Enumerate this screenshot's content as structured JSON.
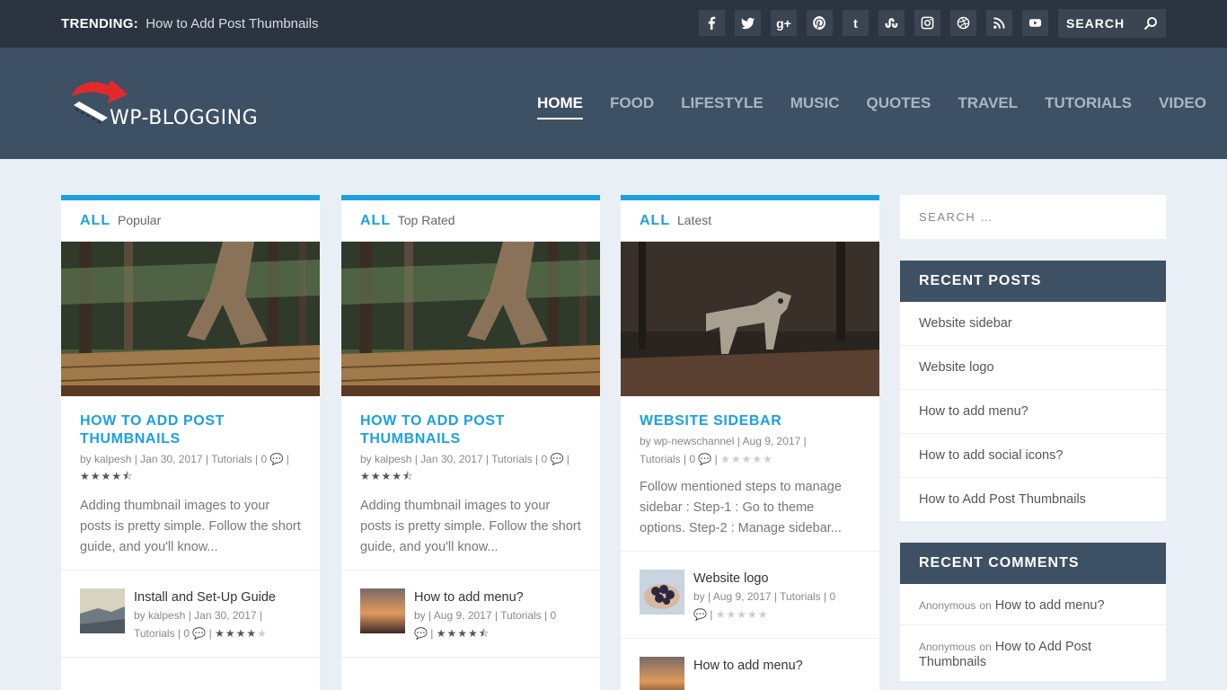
{
  "topbar": {
    "trending_label": "TRENDING:",
    "trending_text": "How to Add Post Thumbnails",
    "social_icons": [
      "facebook-icon",
      "twitter-icon",
      "google-plus-icon",
      "pinterest-icon",
      "tumblr-icon",
      "stumbleupon-icon",
      "instagram-icon",
      "dribbble-icon",
      "rss-icon",
      "youtube-icon"
    ],
    "search_placeholder": "SEARCH"
  },
  "header": {
    "logo_text": "WP-BLOGGING",
    "nav": [
      "HOME",
      "FOOD",
      "LIFESTYLE",
      "MUSIC",
      "QUOTES",
      "TRAVEL",
      "TUTORIALS",
      "VIDEO"
    ],
    "active": "HOME"
  },
  "cards": [
    {
      "tab_all": "ALL",
      "tab_sub": "Popular",
      "image": "forest-hiker",
      "title": "HOW TO ADD POST THUMBNAILS",
      "meta_line1": "by kalpesh | Jan 30, 2017 | Tutorials | 0 💬 |",
      "rating": 4.5,
      "excerpt": "Adding thumbnail images to your posts is pretty simple. Follow the short guide, and you'll know...",
      "mini": {
        "title": "Install and Set-Up Guide",
        "meta_line1": "by kalpesh | Jan 30, 2017 |",
        "meta_line2": "Tutorials | 0 💬 |",
        "rating": 4
      }
    },
    {
      "tab_all": "ALL",
      "tab_sub": "Top Rated",
      "image": "forest-hiker",
      "title": "HOW TO ADD POST THUMBNAILS",
      "meta_line1": "by kalpesh | Jan 30, 2017 | Tutorials | 0 💬 |",
      "rating": 4.5,
      "excerpt": "Adding thumbnail images to your posts is pretty simple. Follow the short guide, and you'll know...",
      "mini": {
        "title": "How to add menu?",
        "meta_line1": "by | Aug 9, 2017 | Tutorials | 0",
        "meta_line2": "💬 |",
        "rating": 4.5
      }
    },
    {
      "tab_all": "ALL",
      "tab_sub": "Latest",
      "image": "wolf",
      "title": "WEBSITE SIDEBAR",
      "meta_line1": "by wp-newschannel | Aug 9, 2017 |",
      "meta_line2": "Tutorials | 0 💬 |",
      "rating": 0,
      "excerpt": "Follow mentioned steps to manage sidebar : Step-1 : Go to theme options. Step-2 : Manage sidebar...",
      "mini": {
        "title": "Website logo",
        "meta_line1": "by | Aug 9, 2017 | Tutorials | 0",
        "meta_line2": "💬 |",
        "rating": 0
      },
      "mini2_title": "How to add menu?"
    }
  ],
  "sidebar": {
    "search_placeholder": "SEARCH …",
    "recent_posts_title": "RECENT POSTS",
    "recent_posts": [
      "Website sidebar",
      "Website logo",
      "How to add menu?",
      "How to add social icons?",
      "How to Add Post Thumbnails"
    ],
    "recent_comments_title": "RECENT COMMENTS",
    "recent_comments": [
      {
        "author": "Anonymous",
        "on": "on",
        "post": "How to add menu?"
      },
      {
        "author": "Anonymous",
        "on": "on",
        "post": "How to Add Post Thumbnails"
      }
    ]
  },
  "colors": {
    "accent": "#1ba0e2",
    "topbar": "#2b3440",
    "header": "#3e5064",
    "page_bg": "#e9eff4"
  }
}
